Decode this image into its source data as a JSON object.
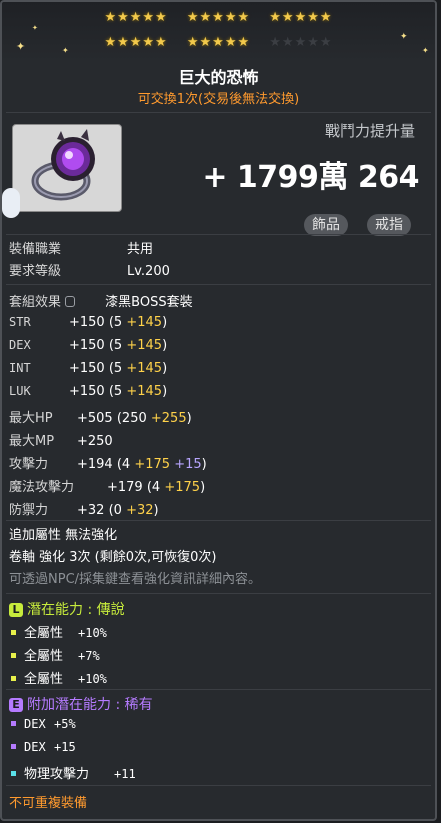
{
  "stars": {
    "row1": [
      "★★★★★",
      "★★★★★",
      "★★★★★"
    ],
    "row2_gold": [
      "★★★★★",
      "★★★★★"
    ],
    "row2_empty": "★★★★★"
  },
  "item": {
    "name": "巨大的恐怖",
    "trade_note": "可交換1次(交易後無法交換)",
    "combat_power_label": "戰鬥力提升量",
    "combat_power_value": "+ 1799萬 264",
    "tags": [
      "飾品",
      "戒指"
    ]
  },
  "requirements": [
    {
      "label": "裝備職業",
      "value": "共用"
    },
    {
      "label": "要求等級",
      "value": "Lv.200"
    }
  ],
  "set_effect": {
    "label": "套組效果",
    "value": "漆黑BOSS套裝"
  },
  "stats": [
    {
      "name": "STR",
      "total": "+150",
      "base": "(5",
      "bonus": "+145",
      "close": ")"
    },
    {
      "name": "DEX",
      "total": "+150",
      "base": "(5",
      "bonus": "+145",
      "close": ")"
    },
    {
      "name": "INT",
      "total": "+150",
      "base": "(5",
      "bonus": "+145",
      "close": ")"
    },
    {
      "name": "LUK",
      "total": "+150",
      "base": "(5",
      "bonus": "+145",
      "close": ")"
    },
    {
      "name": "最大HP",
      "total": "+505",
      "base": "(250",
      "bonus": "+255",
      "close": ")"
    },
    {
      "name": "最大MP",
      "total": "+250",
      "base": "",
      "bonus": "",
      "close": ""
    },
    {
      "name": "攻擊力",
      "total": "+194",
      "base": "(4",
      "bonus": "+175",
      "extra": "+15",
      "close": ")"
    },
    {
      "name": "魔法攻擊力",
      "total": "+179",
      "base": "(4",
      "bonus": "+175",
      "close": ")"
    },
    {
      "name": "防禦力",
      "total": "+32",
      "base": "(0",
      "bonus": "+32",
      "close": ")"
    }
  ],
  "extra": {
    "additional": "追加屬性 無法強化",
    "scroll": "卷軸 強化 3次 (剩餘0次,可恢復0次)",
    "note": "可透過NPC/採集鍵查看強化資訊詳細內容。"
  },
  "potential": {
    "badge": "L",
    "title": "潛在能力 : 傳說",
    "lines": [
      {
        "name": "全屬性",
        "value": "+10%"
      },
      {
        "name": "全屬性",
        "value": "+7%"
      },
      {
        "name": "全屬性",
        "value": "+10%"
      }
    ]
  },
  "additional_potential": {
    "badge": "E",
    "title": "附加潛在能力 : 稀有",
    "lines": [
      {
        "name": "DEX",
        "value": "+5%",
        "color": "purple"
      },
      {
        "name": "DEX",
        "value": "+15",
        "color": "purple"
      },
      {
        "name": "物理攻擊力",
        "value": "+11",
        "color": "cyan"
      }
    ]
  },
  "footer": "不可重複裝備",
  "colors": {
    "gold": "#ffd24a",
    "purple": "#b8a6ff",
    "orange": "#ff9a2e",
    "legendary": "#c7ec3c",
    "epic": "#b57bff"
  }
}
